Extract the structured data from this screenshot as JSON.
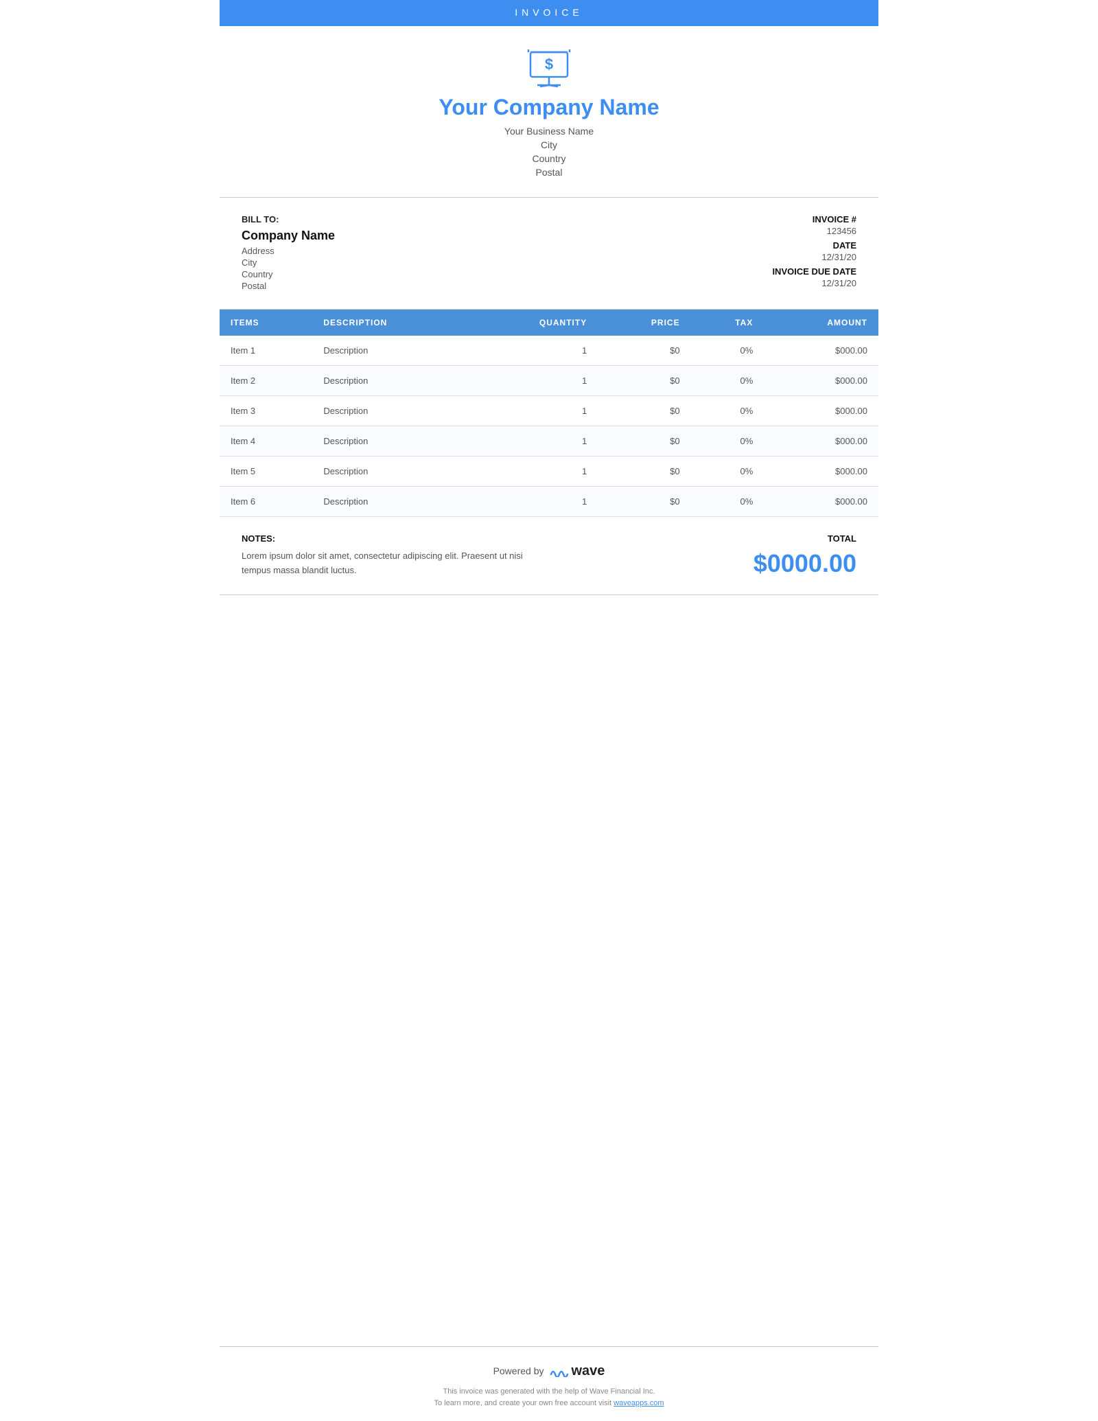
{
  "topBar": {
    "label": "INVOICE"
  },
  "companyHeader": {
    "companyName": "Your Company Name",
    "businessName": "Your Business Name",
    "city": "City",
    "country": "Country",
    "postal": "Postal"
  },
  "billing": {
    "billToLabel": "BILL TO:",
    "clientName": "Company Name",
    "address": "Address",
    "city": "City",
    "country": "Country",
    "postal": "Postal"
  },
  "invoiceInfo": {
    "invoiceNumLabel": "INVOICE #",
    "invoiceNum": "123456",
    "dateLabel": "DATE",
    "date": "12/31/20",
    "dueDateLabel": "INVOICE DUE DATE",
    "dueDate": "12/31/20"
  },
  "table": {
    "headers": {
      "items": "ITEMS",
      "description": "DESCRIPTION",
      "quantity": "QUANTITY",
      "price": "PRICE",
      "tax": "TAX",
      "amount": "AMOUNT"
    },
    "rows": [
      {
        "item": "Item 1",
        "description": "Description",
        "quantity": "1",
        "price": "$0",
        "tax": "0%",
        "amount": "$000.00"
      },
      {
        "item": "Item 2",
        "description": "Description",
        "quantity": "1",
        "price": "$0",
        "tax": "0%",
        "amount": "$000.00"
      },
      {
        "item": "Item 3",
        "description": "Description",
        "quantity": "1",
        "price": "$0",
        "tax": "0%",
        "amount": "$000.00"
      },
      {
        "item": "Item 4",
        "description": "Description",
        "quantity": "1",
        "price": "$0",
        "tax": "0%",
        "amount": "$000.00"
      },
      {
        "item": "Item 5",
        "description": "Description",
        "quantity": "1",
        "price": "$0",
        "tax": "0%",
        "amount": "$000.00"
      },
      {
        "item": "Item 6",
        "description": "Description",
        "quantity": "1",
        "price": "$0",
        "tax": "0%",
        "amount": "$000.00"
      }
    ]
  },
  "notes": {
    "label": "NOTES:",
    "text": "Lorem ipsum dolor sit amet, consectetur adipiscing elit. Praesent ut nisi tempus massa blandit luctus."
  },
  "total": {
    "label": "TOTAL",
    "amount": "$0000.00"
  },
  "footer": {
    "poweredBy": "Powered by",
    "waveName": "wave",
    "smallText1": "This invoice was generated with the help of Wave Financial Inc.",
    "smallText2": "To learn more, and create your own free account visit",
    "link": "waveapps.com"
  },
  "colors": {
    "blue": "#3d8ef0",
    "tableHeaderBg": "#4a90d9"
  }
}
